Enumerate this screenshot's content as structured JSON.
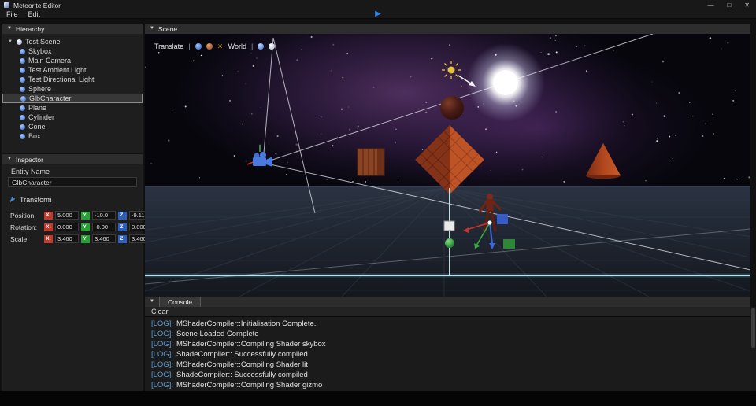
{
  "window": {
    "title": "Meteorite Editor",
    "controls": {
      "minimize": "—",
      "maximize": "□",
      "close": "✕"
    }
  },
  "menu": {
    "items": [
      "File",
      "Edit"
    ],
    "play_icon": "▶"
  },
  "icons": {
    "collapse": "▼",
    "expand": "▼"
  },
  "hierarchy": {
    "title": "Hierarchy",
    "root": "Test Scene",
    "items": [
      "Skybox",
      "Main Camera",
      "Test Ambient Light",
      "Test Directional Light",
      "Sphere",
      "GlbCharacter",
      "Plane",
      "Cylinder",
      "Cone",
      "Box"
    ],
    "selected_item": "GlbCharacter"
  },
  "inspector": {
    "title": "Inspector",
    "entity_name_label": "Entity Name",
    "entity_name": "GlbCharacter",
    "transform": {
      "title": "Transform",
      "axes": [
        "X:",
        "Y:",
        "Z:"
      ],
      "rows": [
        {
          "label": "Position:",
          "x": "5.000",
          "y": "-10.0",
          "z": "-9.11"
        },
        {
          "label": "Rotation:",
          "x": "0.000",
          "y": "-0.00",
          "z": "0.000"
        },
        {
          "label": "Scale:",
          "x": "3.460",
          "y": "3.460",
          "z": "3.460"
        }
      ]
    }
  },
  "scene": {
    "title": "Scene",
    "toolbar": {
      "translate_label": "Translate",
      "world_label": "World",
      "separator": "|"
    }
  },
  "console": {
    "title": "Console",
    "clear_label": "Clear",
    "logs": [
      {
        "tag": "[LOG]:",
        "text": "MShaderCompiler::Initialisation Complete."
      },
      {
        "tag": "[LOG]:",
        "text": "Scene Loaded Complete"
      },
      {
        "tag": "[LOG]:",
        "text": "MShaderCompiler::Compiling Shader skybox"
      },
      {
        "tag": "[LOG]:",
        "text": "ShadeCompiler:: Successfully compiled"
      },
      {
        "tag": "[LOG]:",
        "text": "MShaderCompiler::Compiling Shader lit"
      },
      {
        "tag": "[LOG]:",
        "text": "ShadeCompiler:: Successfully compiled"
      },
      {
        "tag": "[LOG]:",
        "text": "MShaderCompiler::Compiling Shader gizmo"
      }
    ]
  },
  "colors": {
    "axis_x": "#c0392b",
    "axis_y": "#27a035",
    "axis_z": "#2b5fc0",
    "log_tag": "#5b9bd5",
    "play": "#2f80e8",
    "grid_axis": "#b5e6f2"
  }
}
